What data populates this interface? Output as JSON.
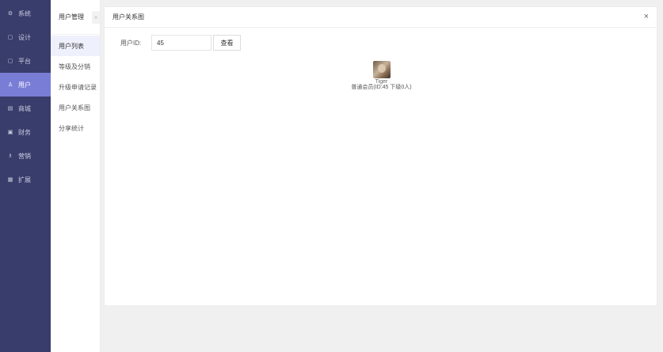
{
  "sidebar": {
    "items": [
      {
        "label": "系统",
        "icon": "gear-icon",
        "glyph": "⚙"
      },
      {
        "label": "设计",
        "icon": "monitor-icon",
        "glyph": "▢"
      },
      {
        "label": "平台",
        "icon": "monitor-icon",
        "glyph": "▢"
      },
      {
        "label": "用户",
        "icon": "user-icon",
        "glyph": "♙"
      },
      {
        "label": "商城",
        "icon": "shop-icon",
        "glyph": "▤"
      },
      {
        "label": "财务",
        "icon": "finance-icon",
        "glyph": "▣"
      },
      {
        "label": "营销",
        "icon": "marketing-icon",
        "glyph": "♗"
      },
      {
        "label": "扩展",
        "icon": "grid-icon",
        "glyph": "▦"
      }
    ]
  },
  "subnav": {
    "title": "用户管理",
    "collapse_glyph": "«",
    "items": [
      {
        "label": "用户列表"
      },
      {
        "label": "等级及分销"
      },
      {
        "label": "升级申请记录"
      },
      {
        "label": "用户关系图"
      },
      {
        "label": "分享统计"
      }
    ]
  },
  "panel": {
    "title": "用户关系图",
    "close_glyph": "×",
    "form": {
      "label": "用户ID:",
      "value": "45",
      "button": "查看"
    },
    "node": {
      "name": "Tiger",
      "info": "普通会员(ID:45 下级0人)"
    }
  }
}
